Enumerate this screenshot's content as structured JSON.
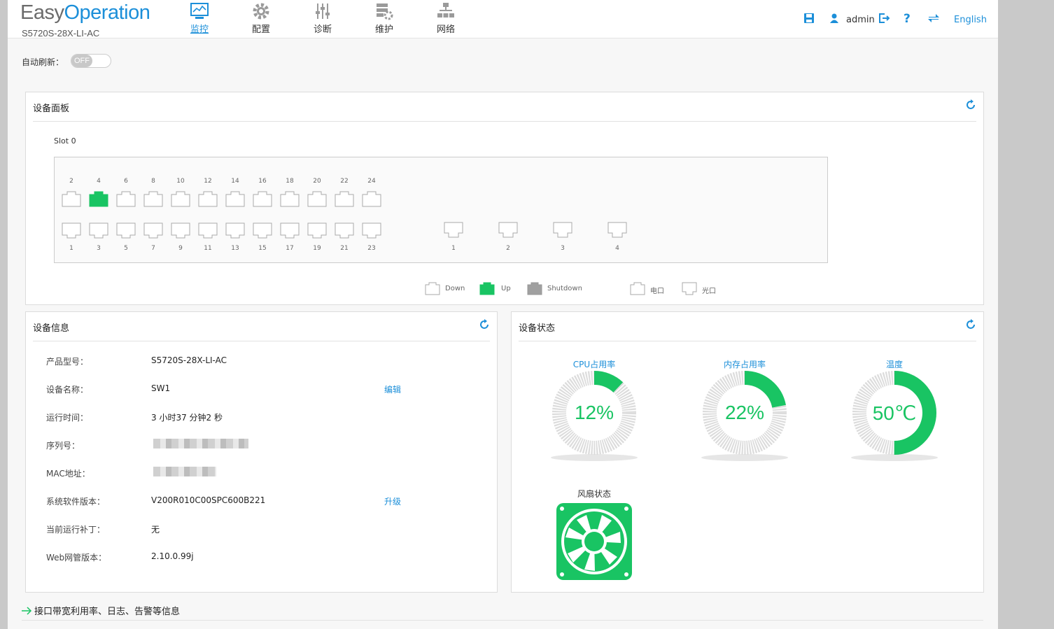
{
  "brand": {
    "part1": "Easy",
    "part2": "Operation",
    "model": "S5720S-28X-LI-AC"
  },
  "nav": [
    {
      "label": "监控",
      "icon": "monitor-icon",
      "active": true
    },
    {
      "label": "配置",
      "icon": "gear-icon"
    },
    {
      "label": "诊断",
      "icon": "sliders-icon"
    },
    {
      "label": "维护",
      "icon": "maintenance-icon"
    },
    {
      "label": "网络",
      "icon": "network-icon"
    }
  ],
  "header_right": {
    "user": "admin",
    "help": "?",
    "language": "English"
  },
  "auto_refresh": {
    "label": "自动刷新：",
    "state": "OFF"
  },
  "device_panel": {
    "title": "设备面板",
    "slot": "Slot 0",
    "top_ports": [
      "2",
      "4",
      "6",
      "8",
      "10",
      "12",
      "14",
      "16",
      "18",
      "20",
      "22",
      "24"
    ],
    "bottom_ports": [
      "1",
      "3",
      "5",
      "7",
      "9",
      "11",
      "13",
      "15",
      "17",
      "19",
      "21",
      "23"
    ],
    "up_ports": [
      "4"
    ],
    "optical_ports": [
      "1",
      "2",
      "3",
      "4"
    ],
    "legend": {
      "down": "Down",
      "up": "Up",
      "shutdown": "Shutdown",
      "electrical": "电口",
      "optical": "光口"
    },
    "colors": {
      "up": "#19c463",
      "shutdown": "#a0a0a0"
    }
  },
  "device_info": {
    "title": "设备信息",
    "rows": [
      {
        "label": "产品型号：",
        "value": "S5720S-28X-LI-AC"
      },
      {
        "label": "设备名称：",
        "value": "SW1",
        "action": "编辑"
      },
      {
        "label": "运行时间：",
        "value": "3 小时37 分钟2 秒"
      },
      {
        "label": "序列号：",
        "value": ""
      },
      {
        "label": "MAC地址：",
        "value": ""
      },
      {
        "label": "系统软件版本：",
        "value": "V200R010C00SPC600B221",
        "action": "升级"
      },
      {
        "label": "当前运行补丁：",
        "value": "无"
      },
      {
        "label": "Web网管版本：",
        "value": "2.10.0.99j"
      }
    ]
  },
  "device_status": {
    "title": "设备状态",
    "gauges": [
      {
        "title": "CPU占用率",
        "value_text": "12%",
        "fraction": 0.12
      },
      {
        "title": "内存占用率",
        "value_text": "22%",
        "fraction": 0.22
      },
      {
        "title": "温度",
        "value_text": "50℃",
        "fraction": 0.5
      }
    ],
    "fan_title": "风扇状态",
    "colors": {
      "accent": "#19c463",
      "track": "#dcdcdc"
    }
  },
  "bottom_link": "接口带宽利用率、日志、告警等信息",
  "colors": {
    "brand": "#1c8fd9"
  }
}
